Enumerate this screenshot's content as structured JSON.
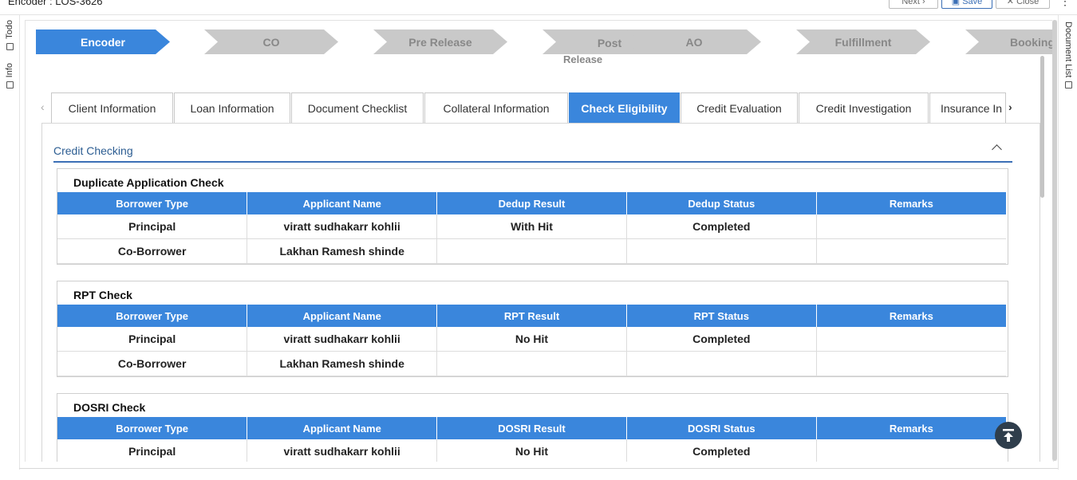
{
  "header": {
    "title": "Encoder : LOS-3626",
    "next_label": "Next",
    "save_label": "Save",
    "close_label": "Close"
  },
  "left_rail": {
    "todo_label": "Todo",
    "info_label": "Info"
  },
  "right_rail": {
    "document_list_label": "Document List"
  },
  "stepper": {
    "steps": [
      "Encoder",
      "CO",
      "Pre Release",
      "Post",
      "AO",
      "Fulfillment",
      "Booking"
    ],
    "post_sub": "Release",
    "active_index": 0
  },
  "tabs": {
    "items": [
      "Client Information",
      "Loan Information",
      "Document Checklist",
      "Collateral Information",
      "Check Eligibility",
      "Credit Evaluation",
      "Credit Investigation",
      "Insurance In"
    ],
    "active_index": 4
  },
  "section": {
    "title": "Credit Checking"
  },
  "duplicate_check": {
    "title": "Duplicate Application Check",
    "headers": [
      "Borrower Type",
      "Applicant Name",
      "Dedup Result",
      "Dedup Status",
      "Remarks"
    ],
    "rows": [
      [
        "Principal",
        "viratt sudhakarr kohlii",
        "With Hit",
        "Completed",
        ""
      ],
      [
        "Co-Borrower",
        "Lakhan Ramesh shinde",
        "",
        "",
        ""
      ]
    ]
  },
  "rpt_check": {
    "title": "RPT Check",
    "headers": [
      "Borrower Type",
      "Applicant Name",
      "RPT Result",
      "RPT Status",
      "Remarks"
    ],
    "rows": [
      [
        "Principal",
        "viratt sudhakarr kohlii",
        "No Hit",
        "Completed",
        ""
      ],
      [
        "Co-Borrower",
        "Lakhan Ramesh shinde",
        "",
        "",
        ""
      ]
    ]
  },
  "dosri_check": {
    "title": "DOSRI Check",
    "headers": [
      "Borrower Type",
      "Applicant Name",
      "DOSRI Result",
      "DOSRI Status",
      "Remarks"
    ],
    "rows": [
      [
        "Principal",
        "viratt sudhakarr kohlii",
        "No Hit",
        "Completed",
        ""
      ]
    ]
  },
  "colors": {
    "accent": "#3a86dc",
    "inactive_step": "#c9c9c9",
    "section_title": "#2c5d92",
    "fab": "#2f3e4c"
  }
}
